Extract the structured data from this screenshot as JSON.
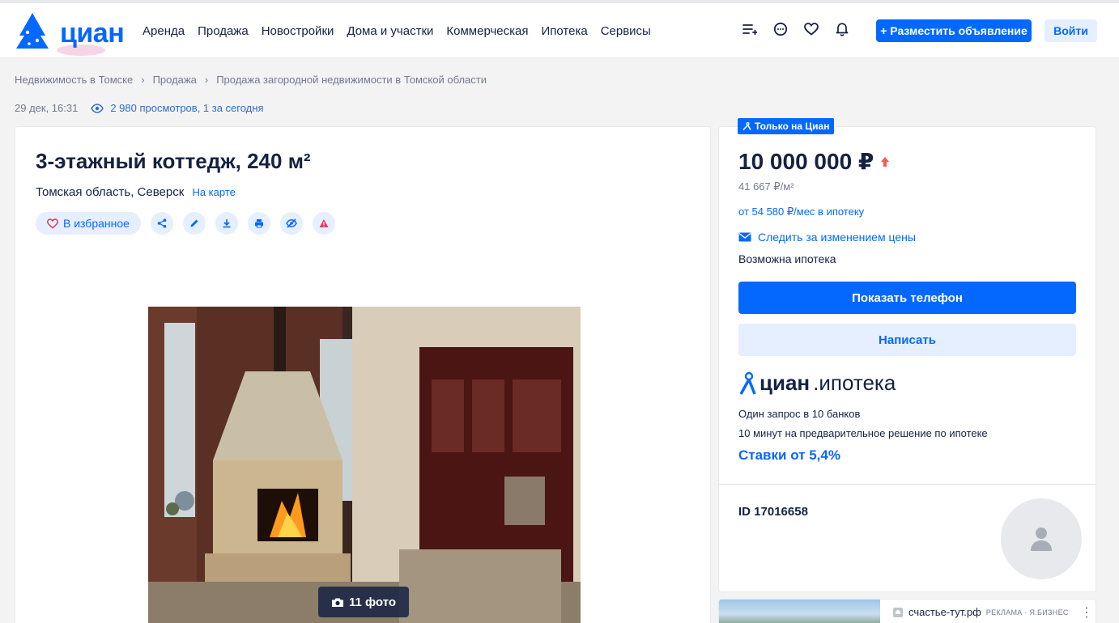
{
  "header": {
    "logo_text": "циан",
    "nav": [
      "Аренда",
      "Продажа",
      "Новостройки",
      "Дома и участки",
      "Коммерческая",
      "Ипотека",
      "Сервисы"
    ],
    "post_button": "+ Разместить объявление",
    "login_button": "Войти",
    "icons": [
      "compare-list-icon",
      "chat-icon",
      "heart-icon",
      "bell-icon"
    ]
  },
  "breadcrumb": [
    "Недвижимость в Томске",
    "Продажа",
    "Продажа загородной недвижимости в Томской области"
  ],
  "meta": {
    "date": "29 дек, 16:31",
    "views": "2 980 просмотров, 1 за сегодня"
  },
  "listing": {
    "title": "3-этажный коттедж, 240 м²",
    "address": "Томская область, Северск",
    "map_link": "На карте",
    "favorite_label": "В избранное",
    "photo_count": "11 фото",
    "action_icons": [
      "share-icon",
      "edit-icon",
      "download-icon",
      "print-icon",
      "hide-icon",
      "report-icon"
    ]
  },
  "sidebar": {
    "badge": "Только на Циан",
    "price": "10 000 000 ₽",
    "price_per_m2": "41 667 ₽/м²",
    "mortgage_link": "от 54 580 ₽/мес в ипотеку",
    "follow_price": "Следить за изменением цены",
    "mortgage_possible": "Возможна ипотека",
    "phone_button": "Показать телефон",
    "write_button": "Написать",
    "ipoteka_brand": "циан",
    "ipoteka_suffix": ".ипотека",
    "ipoteka_line1": "Один запрос в 10 банков",
    "ipoteka_line2": "10 минут на предварительное решение по ипотеке",
    "ipoteka_rate": "Ставки от 5,4%",
    "id_text": "ID 17016658"
  },
  "ad": {
    "site": "счастье-тут.рф",
    "tag": "РЕКЛАМА · Я.БИЗНЕС"
  },
  "colors": {
    "accent": "#0468ff",
    "accent_light": "#e6efff",
    "text": "#152242",
    "muted": "#737a8e",
    "price_up": "#ff5454"
  }
}
